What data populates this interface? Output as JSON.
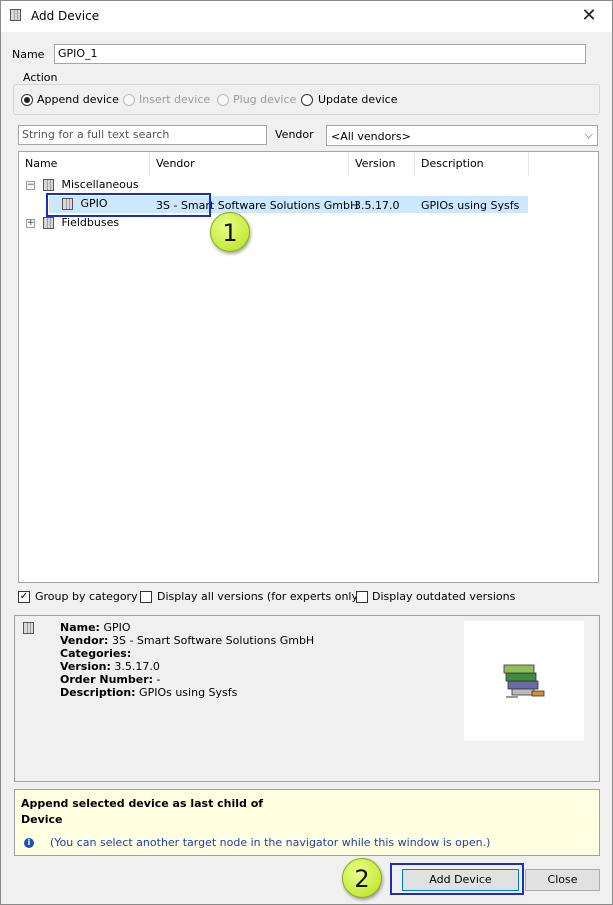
{
  "window": {
    "title": "Add Device",
    "close_glyph": "✕"
  },
  "name_field": {
    "label": "Name",
    "value": "GPIO_1"
  },
  "action": {
    "title": "Action",
    "options": [
      {
        "label": "Append device",
        "checked": true,
        "enabled": true
      },
      {
        "label": "Insert device",
        "checked": false,
        "enabled": false
      },
      {
        "label": "Plug device",
        "checked": false,
        "enabled": false
      },
      {
        "label": "Update device",
        "checked": false,
        "enabled": true
      }
    ]
  },
  "search": {
    "placeholder": "String for a full text search"
  },
  "vendor_filter": {
    "label": "Vendor",
    "value": "<All vendors>"
  },
  "table": {
    "columns": [
      "Name",
      "Vendor",
      "Version",
      "Description"
    ],
    "tree": {
      "cat_misc": "Miscellaneous",
      "cat_fieldbus": "Fieldbuses",
      "device": {
        "name": "GPIO",
        "vendor": "3S - Smart Software Solutions GmbH",
        "version": "3.5.17.0",
        "description": "GPIOs using Sysfs"
      }
    }
  },
  "options": {
    "group_by_category": "Group by category",
    "display_all_versions": "Display all versions (for experts only)",
    "display_outdated": "Display outdated versions"
  },
  "details": {
    "name_label": "Name:",
    "name_value": "GPIO",
    "vendor_label": "Vendor:",
    "vendor_value": "3S - Smart Software Solutions GmbH",
    "categories_label": "Categories:",
    "categories_value": "",
    "version_label": "Version:",
    "version_value": "3.5.17.0",
    "order_label": "Order Number:",
    "order_value": "-",
    "description_label": "Description:",
    "description_value": "GPIOs using Sysfs"
  },
  "hint": {
    "line1": "Append selected device as last child of",
    "line2": "Device",
    "info": "(You can select another target node in the navigator while this window is open.)"
  },
  "buttons": {
    "add": "Add Device",
    "close": "Close"
  },
  "annotations": {
    "step1": "1",
    "step2": "2"
  },
  "colors": {
    "selection": "#cce8ff",
    "annotation_border": "#1a2fc0",
    "annotation_circle": "#c7ea3a",
    "hint_bg": "#ffffe1"
  }
}
